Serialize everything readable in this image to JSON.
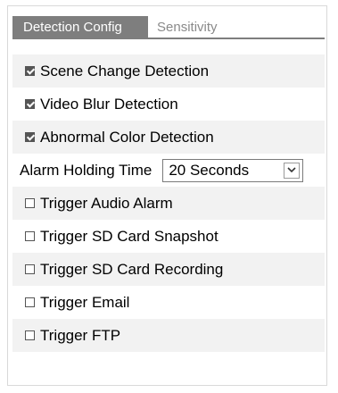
{
  "tabs": {
    "active": "Detection Config",
    "inactive": "Sensitivity"
  },
  "detection_options": [
    {
      "label": "Scene Change Detection",
      "checked": true
    },
    {
      "label": "Video Blur Detection",
      "checked": true
    },
    {
      "label": "Abnormal Color Detection",
      "checked": true
    }
  ],
  "alarm_holding": {
    "label": "Alarm Holding Time",
    "value": "20 Seconds"
  },
  "trigger_options": [
    {
      "label": "Trigger Audio Alarm",
      "checked": false
    },
    {
      "label": "Trigger SD Card Snapshot",
      "checked": false
    },
    {
      "label": "Trigger SD Card Recording",
      "checked": false
    },
    {
      "label": "Trigger Email",
      "checked": false
    },
    {
      "label": "Trigger FTP",
      "checked": false
    }
  ]
}
